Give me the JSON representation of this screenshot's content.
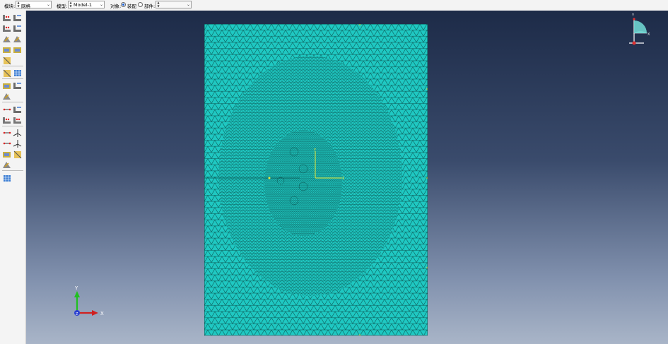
{
  "context_bar": {
    "module_label": "模块:",
    "module_value": "网格",
    "model_label": "模型:",
    "model_value": "Model-1",
    "object_label": "对象:",
    "object_option_assembly": "装配",
    "object_option_part": "部件:",
    "object_selected": "装配",
    "part_value": ""
  },
  "toolbox": {
    "icons": [
      "seed-part-icon",
      "seed-edge-icon",
      "mesh-controls-icon",
      "element-type-icon",
      "mesh-part-icon",
      "delete-mesh-icon",
      "mesh-region-icon",
      "verify-mesh-icon",
      "assign-element-icon",
      "mesh-stats-icon",
      "partition-face-icon",
      "partition-cell-icon",
      "virtual-topology-icon",
      "create-datum-icon",
      "edit-mesh-icon",
      "query-node-icon",
      "datum-point-icon",
      "datum-axis-icon",
      "datum-plane-icon",
      "datum-csys-icon",
      "node-edit-icon",
      "element-edit-icon",
      "merge-icon",
      "adaptivity-icon",
      "remesh-icon"
    ]
  },
  "viewport": {
    "triad_x": "X",
    "triad_y": "Y",
    "triad_z": "Z",
    "view_cube_y": "Y",
    "view_cube_x": "X",
    "origin_x": "X",
    "origin_y": "Y",
    "mesh_color": "#1fc8c2",
    "mesh_line_color": "#0a4c4a"
  }
}
